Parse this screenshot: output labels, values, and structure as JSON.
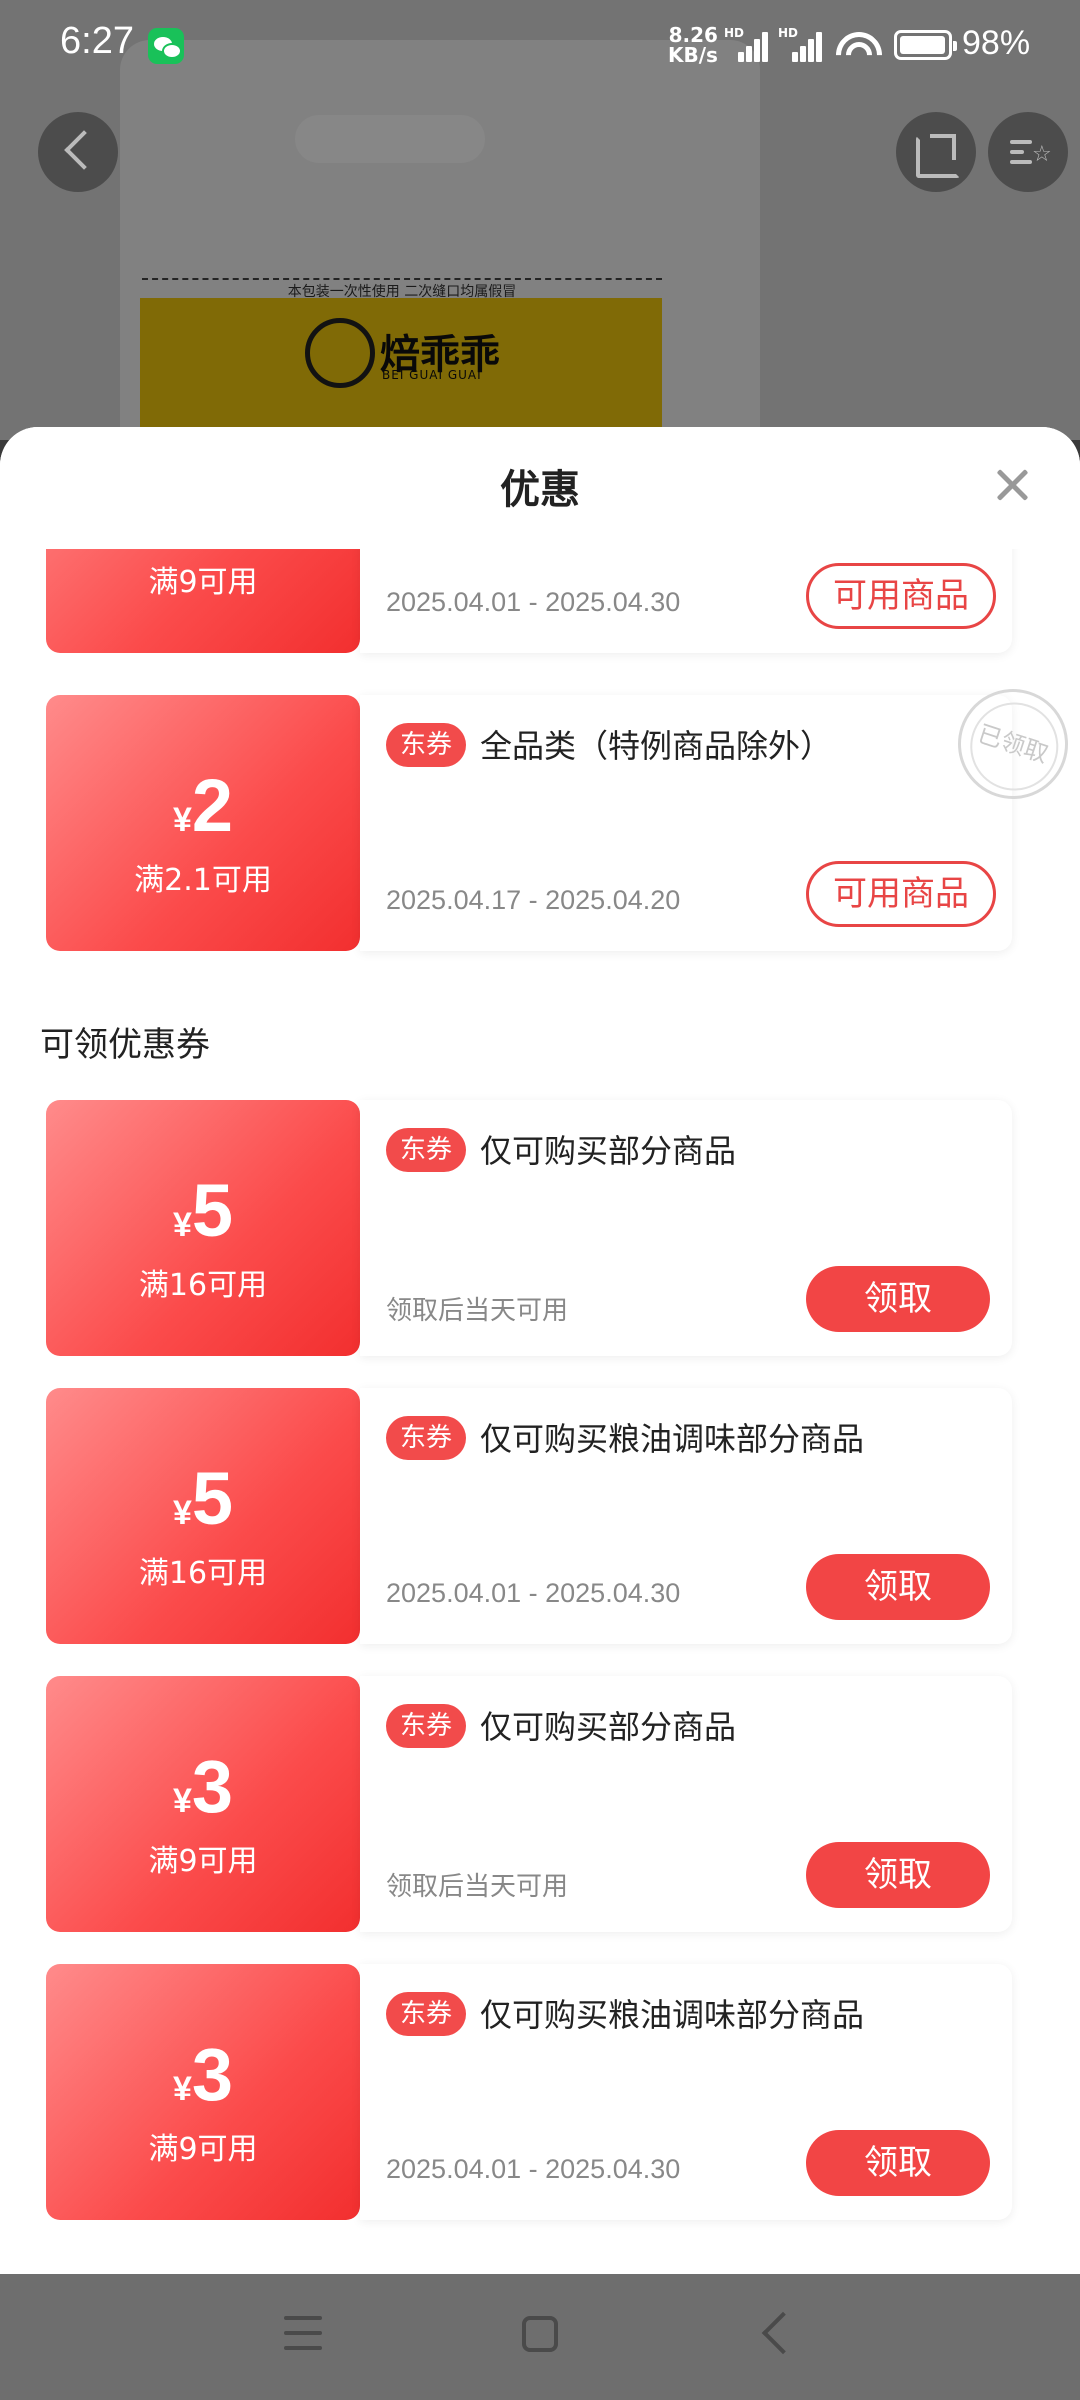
{
  "status_bar": {
    "time": "6:27",
    "net_speed_value": "8.26",
    "net_speed_unit": "KB/s",
    "signal_1_label": "HD",
    "signal_2_label": "HD",
    "battery": "98%"
  },
  "background_product": {
    "bag_notice": "本包装一次性使用  二次缝口均属假冒",
    "brand": "焙乖乖",
    "brand_en": "BEI GUAI GUAI"
  },
  "sheet": {
    "title": "优惠",
    "close_icon": "close-icon"
  },
  "received_coupons": [
    {
      "threshold": "满9可用",
      "date": "2025.04.01 - 2025.04.30",
      "action": "可用商品"
    },
    {
      "currency": "¥",
      "amount": "2",
      "threshold": "满2.1可用",
      "tag": "东券",
      "desc": "全品类（特例商品除外）",
      "date": "2025.04.17 - 2025.04.20",
      "action": "可用商品",
      "stamp": "已领取"
    }
  ],
  "claimable_section_title": "可领优惠券",
  "claimable_coupons": [
    {
      "currency": "¥",
      "amount": "5",
      "threshold": "满16可用",
      "tag": "东券",
      "desc": "仅可购买部分商品",
      "date": "领取后当天可用",
      "action": "领取"
    },
    {
      "currency": "¥",
      "amount": "5",
      "threshold": "满16可用",
      "tag": "东券",
      "desc": "仅可购买粮油调味部分商品",
      "date": "2025.04.01 - 2025.04.30",
      "action": "领取"
    },
    {
      "currency": "¥",
      "amount": "3",
      "threshold": "满9可用",
      "tag": "东券",
      "desc": "仅可购买部分商品",
      "date": "领取后当天可用",
      "action": "领取"
    },
    {
      "currency": "¥",
      "amount": "3",
      "threshold": "满9可用",
      "tag": "东券",
      "desc": "仅可购买粮油调味部分商品",
      "date": "2025.04.01 - 2025.04.30",
      "action": "领取"
    }
  ]
}
